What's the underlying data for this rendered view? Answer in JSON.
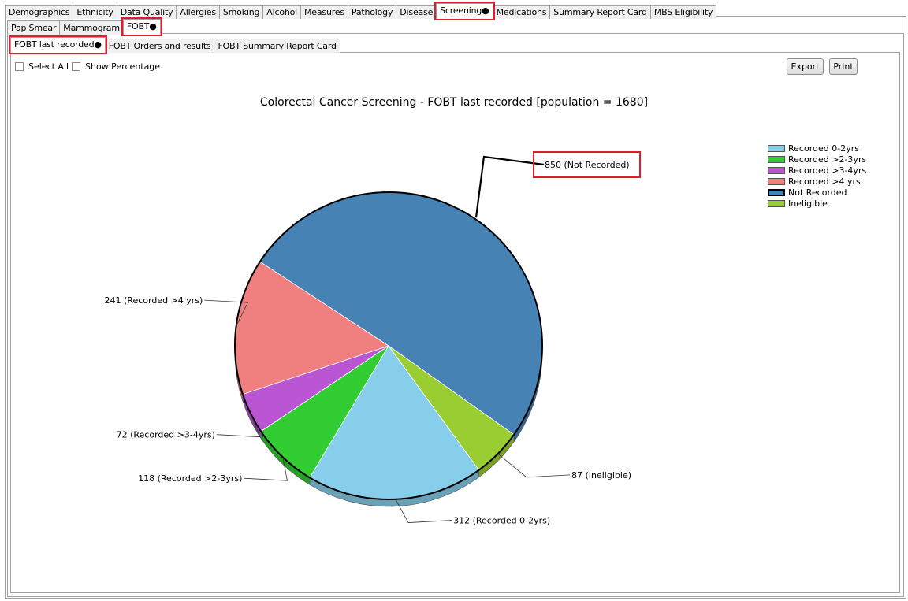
{
  "top_tabs": [
    {
      "label": "Demographics"
    },
    {
      "label": "Ethnicity"
    },
    {
      "label": "Data Quality"
    },
    {
      "label": "Allergies"
    },
    {
      "label": "Smoking"
    },
    {
      "label": "Alcohol"
    },
    {
      "label": "Measures"
    },
    {
      "label": "Pathology"
    },
    {
      "label": "Disease"
    },
    {
      "label": "Screening●"
    },
    {
      "label": "Medications"
    },
    {
      "label": "Summary Report Card"
    },
    {
      "label": "MBS Eligibility"
    }
  ],
  "screening_tabs": [
    {
      "label": "Pap Smear"
    },
    {
      "label": "Mammogram"
    },
    {
      "label": "FOBT●"
    }
  ],
  "fobt_tabs": [
    {
      "label": "FOBT last recorded●"
    },
    {
      "label": "FOBT Orders and results"
    },
    {
      "label": "FOBT Summary Report Card"
    }
  ],
  "options": {
    "select_all": "Select All",
    "show_percentage": "Show Percentage"
  },
  "toolbar": {
    "export_label": "Export",
    "print_label": "Print"
  },
  "chart_data": {
    "type": "pie",
    "title": "Colorectal Cancer Screening - FOBT last recorded [population = 1680]",
    "slices": [
      {
        "label": "Recorded 0-2yrs",
        "value": 312,
        "color": "#87ceeb",
        "data_label": "312 (Recorded 0-2yrs)"
      },
      {
        "label": "Recorded >2-3yrs",
        "value": 118,
        "color": "#32cd32",
        "data_label": "118 (Recorded >2-3yrs)"
      },
      {
        "label": "Recorded >3-4yrs",
        "value": 72,
        "color": "#ba55d3",
        "data_label": "72 (Recorded >3-4yrs)"
      },
      {
        "label": "Recorded >4 yrs",
        "value": 241,
        "color": "#f08080",
        "data_label": "241 (Recorded >4 yrs)"
      },
      {
        "label": "Not Recorded",
        "value": 850,
        "color": "#4682b4",
        "data_label": "850 (Not Recorded)"
      },
      {
        "label": "Ineligible",
        "value": 87,
        "color": "#9acd32",
        "data_label": "87 (Ineligible)"
      }
    ],
    "legend": [
      "Recorded 0-2yrs",
      "Recorded >2-3yrs",
      "Recorded >3-4yrs",
      "Recorded >4 yrs",
      "Not Recorded",
      "Ineligible"
    ],
    "legend_position": "top-right"
  }
}
